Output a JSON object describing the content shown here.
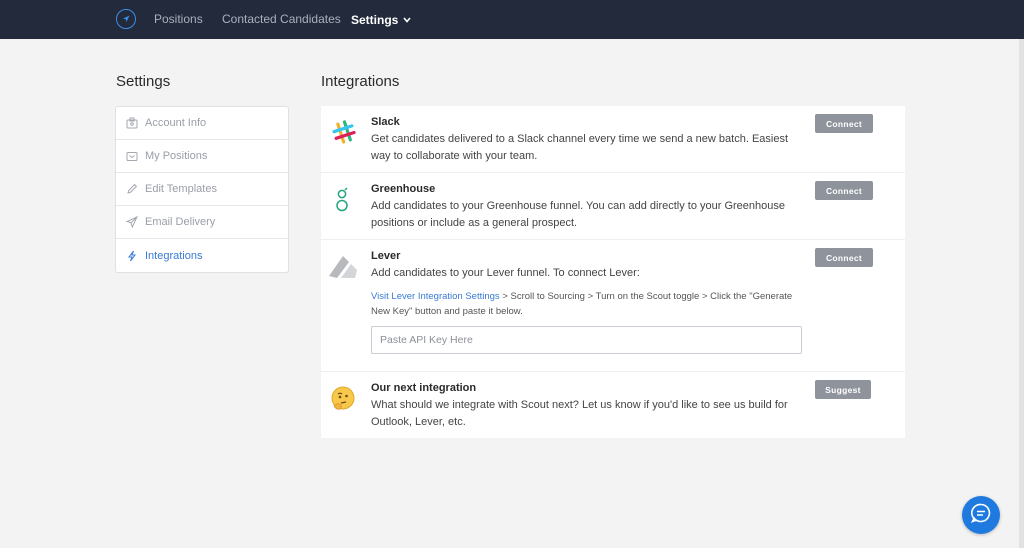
{
  "nav": {
    "items": [
      {
        "label": "Positions"
      },
      {
        "label": "Contacted Candidates"
      },
      {
        "label": "Settings"
      }
    ]
  },
  "sidebar": {
    "heading": "Settings",
    "items": [
      {
        "label": "Account Info",
        "icon": "id-card-icon"
      },
      {
        "label": "My Positions",
        "icon": "inbox-icon"
      },
      {
        "label": "Edit Templates",
        "icon": "pencil-icon"
      },
      {
        "label": "Email Delivery",
        "icon": "paper-plane-icon"
      },
      {
        "label": "Integrations",
        "icon": "lightning-icon",
        "active": true
      }
    ]
  },
  "main": {
    "heading": "Integrations",
    "integrations": [
      {
        "name": "Slack",
        "description": "Get candidates delivered to a Slack channel every time we send a new batch. Easiest way to collaborate with your team.",
        "button": "Connect",
        "icon": "slack-logo-icon"
      },
      {
        "name": "Greenhouse",
        "description": "Add candidates to your Greenhouse funnel. You can add directly to your Greenhouse positions or include as a general prospect.",
        "button": "Connect",
        "icon": "greenhouse-logo-icon"
      },
      {
        "name": "Lever",
        "description": "Add candidates to your Lever funnel. To connect Lever:",
        "button": "Connect",
        "icon": "lever-logo-icon",
        "steps_link": "Visit Lever Integration Settings",
        "steps_text": " > Scroll to Sourcing > Turn on the Scout toggle > Click the \"Generate New Key\" button and paste it below.",
        "input_placeholder": "Paste API Key Here",
        "input_value": ""
      },
      {
        "name": "Our next integration",
        "description": "What should we integrate with Scout next? Let us know if you'd like to see us build for Outlook, Lever, etc.",
        "button": "Suggest",
        "icon": "thinking-face-icon"
      }
    ]
  },
  "colors": {
    "nav_bg": "#232a3c",
    "accent": "#3a7bd5",
    "button_bg": "#8e939c",
    "chat_bg": "#1f7ae0"
  },
  "chat": {
    "icon": "chat-icon"
  }
}
